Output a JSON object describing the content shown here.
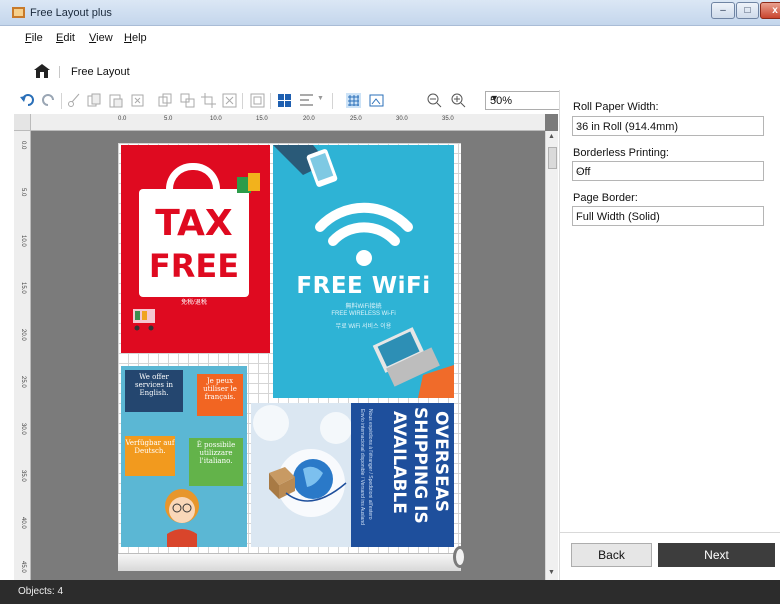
{
  "window": {
    "title": "Free Layout plus",
    "minimize": "–",
    "maximize": "□",
    "close": "x"
  },
  "menu": [
    "File",
    "Edit",
    "View",
    "Help"
  ],
  "breadcrumb": {
    "label": "Free Layout"
  },
  "toolbar": {
    "icons": [
      "undo-icon",
      "redo-icon",
      "cut-icon",
      "copy-icon",
      "paste-icon",
      "delete-icon",
      "duplicate-icon",
      "arrange-icon",
      "crop-icon",
      "fit-icon",
      "fill-icon",
      "layout-icon",
      "align-icon",
      "grid-view-icon",
      "image-view-icon",
      "zoom-out-icon",
      "zoom-in-icon"
    ],
    "zoom_value": "50%"
  },
  "ruler": {
    "h_labels": [
      "0.0",
      "5.0",
      "10.0",
      "15.0",
      "20.0",
      "25.0",
      "30.0",
      "35.0"
    ],
    "v_labels": [
      "0.0",
      "5.0",
      "10.0",
      "15.0",
      "20.0",
      "25.0",
      "30.0",
      "35.0",
      "40.0",
      "45.0"
    ]
  },
  "artwork": {
    "tax": {
      "line1": "TAX",
      "line2": "FREE",
      "jp": "免税/退税"
    },
    "wifi": {
      "title": "FREE WiFi",
      "jp1": "無料WiFi接続",
      "jp2": "FREE WIRELESS Wi-Fi",
      "jp3": "무료 WiFi 서비스 이용"
    },
    "lang": {
      "b1": "We offer services in English.",
      "b2": "Je peux utiliser le français.",
      "b3": "Verfügbar auf Deutsch.",
      "b4": "È possibile utilizzare l'italiano."
    },
    "ship": {
      "line1": "OVERSEAS",
      "line2": "SHIPPING IS",
      "line3": "AVAILABLE",
      "small1": "Nous expédions à l'étranger / Spedizioni all'estero",
      "small2": "Envío internacional disponible / Versand ins Ausland"
    }
  },
  "side_panel": {
    "roll_label": "Roll Paper Width:",
    "roll_value": "36 in Roll (914.4mm)",
    "borderless_label": "Borderless Printing:",
    "borderless_value": "Off",
    "border_label": "Page Border:",
    "border_value": "Full Width (Solid)",
    "back_label": "Back",
    "next_label": "Next"
  },
  "status": {
    "objects": "Objects: 4"
  },
  "colors": {
    "tax_red": "#df0a20",
    "wifi_blue": "#2eb3d5",
    "ship_navy": "#1e4f9c",
    "lang_blue": "#5bb7d4",
    "status_bar": "#2c2c2c"
  }
}
